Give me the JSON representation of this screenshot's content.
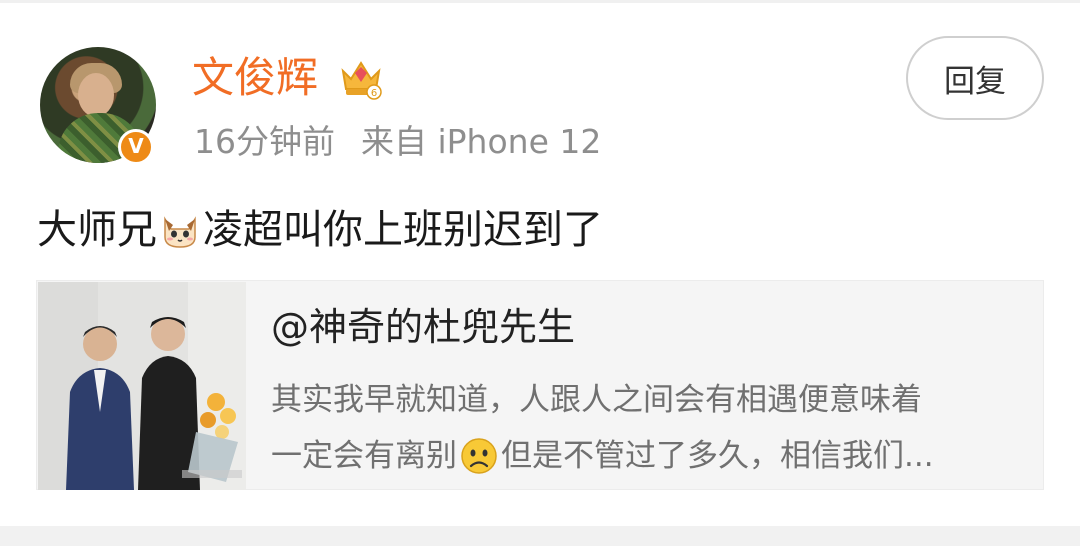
{
  "post": {
    "username": "文俊辉",
    "time": "16分钟前",
    "source": "来自 iPhone 12",
    "reply_label": "回复",
    "text_before": "大师兄",
    "text_after": "凌超叫你上班别迟到了",
    "verified_badge": "V"
  },
  "quoted_card": {
    "title": "@神奇的杜兜先生",
    "desc_line1": "其实我早就知道，人跟人之间会有相遇便意味着",
    "desc_line2_before": "一定会有离别",
    "desc_line2_after": "但是不管过了多久，相信我们..."
  },
  "icons": {
    "avatar": "user-avatar",
    "verified": "verified-v-badge-icon",
    "member": "crown-gem-icon",
    "emoji1": "cat-emoji-icon",
    "emoji2": "sad-face-emoji-icon"
  },
  "colors": {
    "username": "#f16d25",
    "meta": "#8e8e8e",
    "card_bg": "#f5f5f5",
    "badge": "#ee8a16"
  }
}
